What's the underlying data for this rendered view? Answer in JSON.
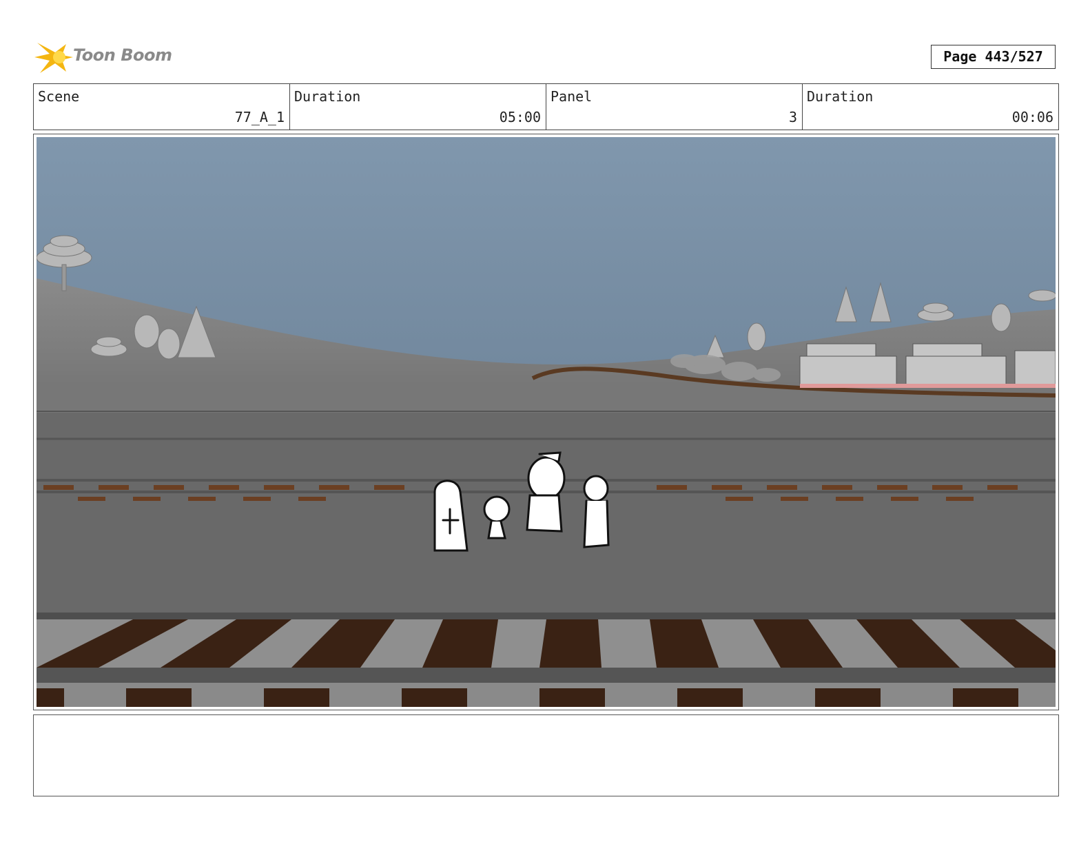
{
  "brand": {
    "logo_text": "Toon Boom",
    "logo_color": "#f2b50f"
  },
  "page": {
    "label": "Page 443/527"
  },
  "header": {
    "scene": {
      "label": "Scene",
      "value": "77_A_1"
    },
    "scene_duration": {
      "label": "Duration",
      "value": "05:00"
    },
    "panel": {
      "label": "Panel",
      "value": "3"
    },
    "panel_duration": {
      "label": "Duration",
      "value": "00:06"
    }
  },
  "panel_image": {
    "description_icon": "storyboard-panel-image"
  },
  "notes": {
    "text": ""
  },
  "colors": {
    "sky": "#7f95ab",
    "ground": "#6a6a6a",
    "tie": "#3a2214"
  }
}
